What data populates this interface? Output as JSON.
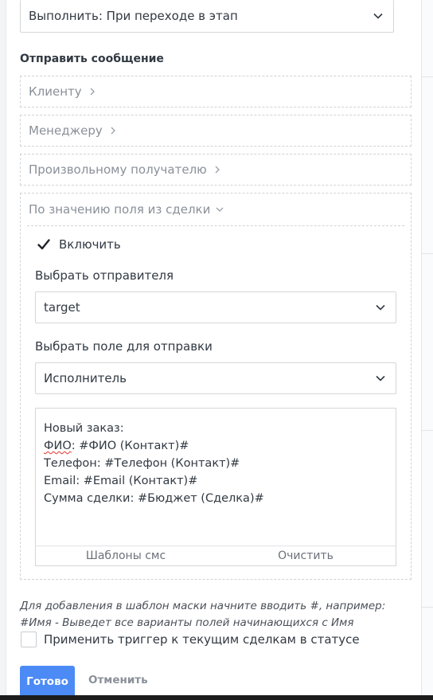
{
  "trigger": {
    "execute_value": "Выполнить: При переходе в этап"
  },
  "send_message": {
    "title": "Отправить сообщение",
    "recipients": [
      {
        "label": "Клиенту",
        "expanded": false
      },
      {
        "label": "Менеджеру",
        "expanded": false
      },
      {
        "label": "Произвольному получателю",
        "expanded": false
      },
      {
        "label": "По значению поля из сделки",
        "expanded": true
      }
    ],
    "by_field": {
      "enable_label": "Включить",
      "enabled": true,
      "sender_label": "Выбрать отправителя",
      "sender_value": "target",
      "field_label": "Выбрать поле для отправки",
      "field_value": "Исполнитель",
      "message": {
        "line1": "Новый заказ:",
        "line2_fio": "ФИО",
        "line2_colon": ":",
        "line2_rest": " #ФИО (Контакт)#",
        "line3": "Телефон: #Телефон (Контакт)#",
        "line4": "Email: #Email (Контакт)#",
        "line5": "Сумма сделки: #Бюджет (Сделка)#"
      },
      "templates_button": "Шаблоны смс",
      "clear_button": "Очистить"
    }
  },
  "hint": {
    "line1": "Для добавления в шаблон маски начните вводить #, например:",
    "line2": "#Имя - Выведет все варианты полей начинающихся с Имя"
  },
  "apply_existing": {
    "label": "Применить триггер к текущим сделкам в статусе",
    "checked": false
  },
  "actions": {
    "done": "Готово",
    "cancel": "Отменить"
  },
  "colors": {
    "primary": "#4c8bf5",
    "border": "#d4d6d9",
    "dashed": "#d0d3d7",
    "muted": "#8a9099"
  },
  "icons": [
    "chevron-down-icon",
    "chevron-right-icon",
    "checkmark-icon"
  ]
}
